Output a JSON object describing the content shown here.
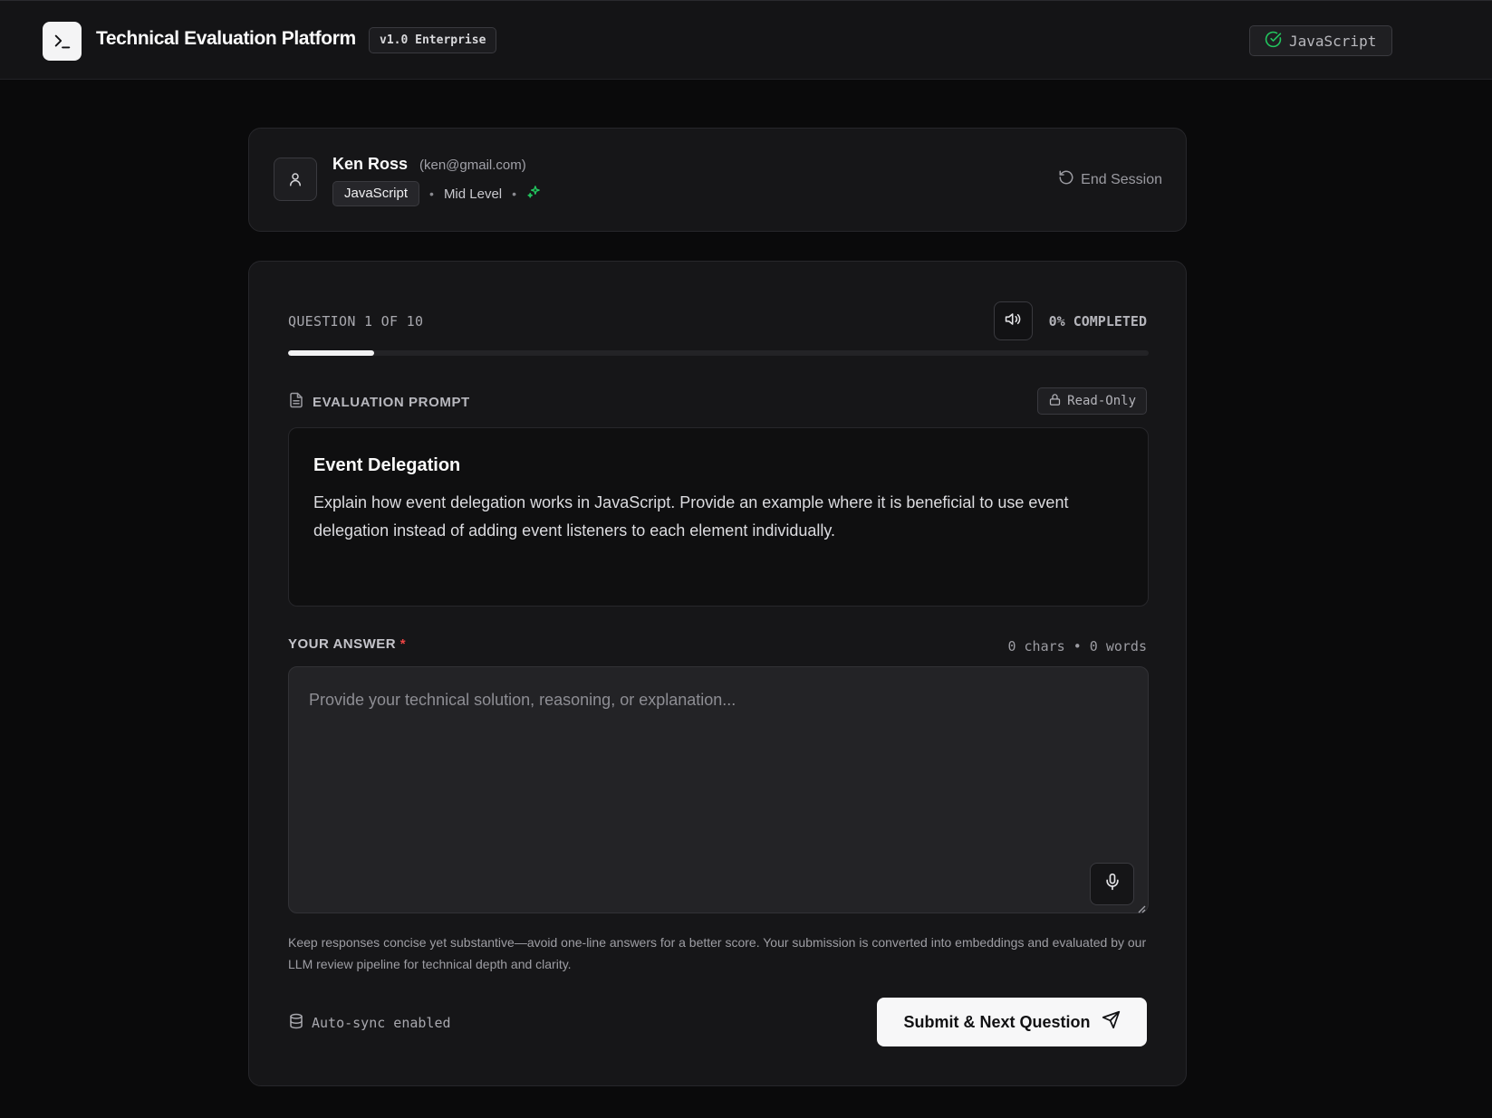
{
  "header": {
    "app_title": "Technical Evaluation Platform",
    "version": "v1.0 Enterprise",
    "language_status": "JavaScript"
  },
  "candidate": {
    "name": "Ken Ross",
    "email": "(ken@gmail.com)",
    "skill": "JavaScript",
    "separator": "•",
    "level": "Mid Level",
    "end_session_label": "End Session"
  },
  "question": {
    "counter": "QUESTION 1 OF 10",
    "completed": "0% COMPLETED",
    "progress_fraction": 0.1,
    "prompt_label": "EVALUATION PROMPT",
    "readonly_label": "Read-Only",
    "title": "Event Delegation",
    "text": "Explain how event delegation works in JavaScript. Provide an example where it is beneficial to use event delegation instead of adding event listeners to each element individually."
  },
  "answer": {
    "label": "YOUR ANSWER",
    "required_mark": "*",
    "counts": "0 chars • 0 words",
    "value": "",
    "placeholder": "Provide your technical solution, reasoning, or explanation..."
  },
  "footer": {
    "hint": "Keep responses concise yet substantive—avoid one-line answers for a better score. Your submission is converted into embeddings and evaluated by our LLM review pipeline for technical depth and clarity.",
    "autosync_label": "Auto-sync enabled",
    "submit_label": "Submit & Next Question"
  },
  "colors": {
    "background": "#0a0a0b",
    "card": "#161618",
    "accent_green": "#22c55e",
    "required_red": "#ef4444",
    "primary_button": "#f7f7f8"
  },
  "icons": {
    "logo": "terminal-icon",
    "language_status": "check-circle-icon",
    "avatar": "user-icon",
    "level_indicator": "sparkles-icon",
    "end_session": "rotate-ccw-icon",
    "speak": "volume-icon",
    "prompt": "file-text-icon",
    "readonly": "lock-icon",
    "mic": "microphone-icon",
    "autosync": "database-icon",
    "submit": "send-icon"
  }
}
